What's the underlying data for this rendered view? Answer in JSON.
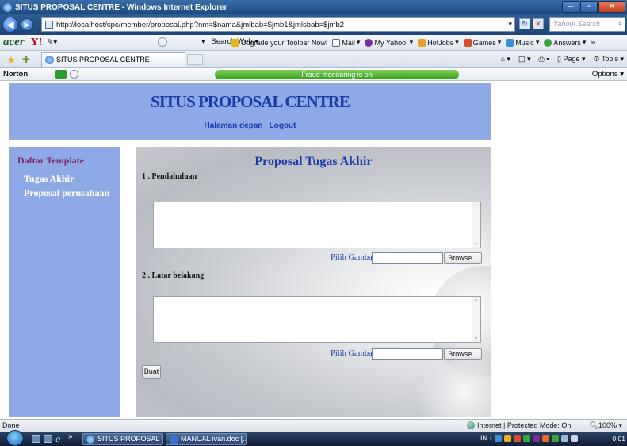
{
  "window": {
    "title": "SITUS PROPOSAL CENTRE - Windows Internet Explorer",
    "minimize_icon": "minimize-icon",
    "maximize_icon": "maximize-icon",
    "close_icon": "close-icon"
  },
  "address_bar": {
    "url": "http://localhost/spc/member/proposal.php?nm=$nama&jmlbab=$jmb1&jmlsbab=$jmb2",
    "search_placeholder": "Yahoo! Search"
  },
  "toolbar": {
    "brand": "acer",
    "yahoo": "Y!",
    "search_web": "Search Web",
    "items": [
      "Upgrade your Toolbar Now!",
      "Mail",
      "My Yahoo!",
      "HotJobs",
      "Games",
      "Music",
      "Answers"
    ],
    "more": "»"
  },
  "tab": {
    "label": "SITUS PROPOSAL CENTRE"
  },
  "command_bar": {
    "page": "Page",
    "tools": "Tools"
  },
  "norton": {
    "brand": "Norton",
    "status": "Fraud monitoring is on",
    "options": "Options"
  },
  "page": {
    "site_title": "SITUS PROPOSAL CENTRE",
    "nav_home": "Halaman depan",
    "nav_sep": "|",
    "nav_logout": "Logout",
    "sidebar_title": "Daftar Template",
    "sidebar_items": [
      "Tugas Akhir",
      "Proposal perusahaan"
    ],
    "main_title": "Proposal Tugas Akhir",
    "section1": "1 . Pendahuluan",
    "section2": "2 . Latar belakang",
    "pick_image": "Pilih Gambar",
    "browse": "Browse...",
    "submit": "Buat"
  },
  "status_bar": {
    "left": "Done",
    "zone": "Internet | Protected Mode: On",
    "zoom": "100%"
  },
  "taskbar": {
    "buttons": [
      "SITUS PROPOSAL C...",
      "MANUAL ivan.doc [..."
    ],
    "lang": "IN",
    "clock": "0:01"
  }
}
